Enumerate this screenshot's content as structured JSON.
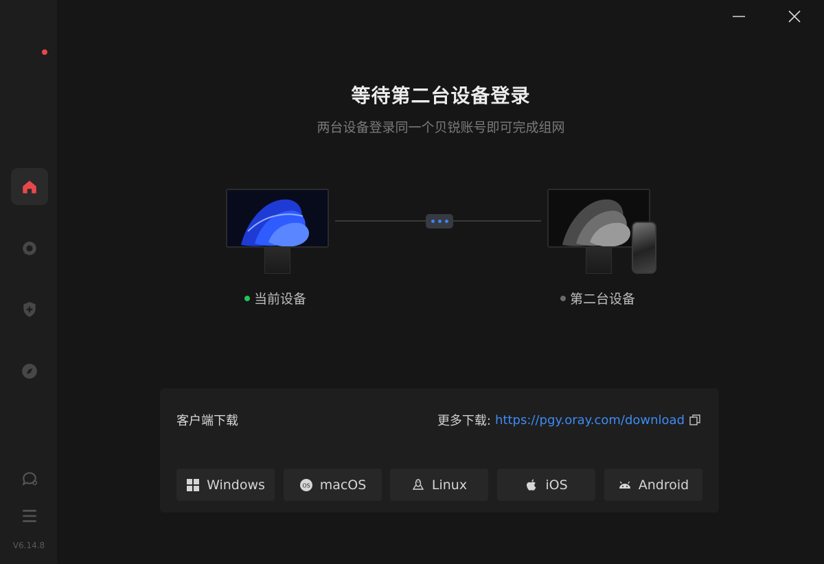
{
  "sidebar": {
    "version": "V6.14.8",
    "nav": [
      {
        "icon": "home-icon",
        "active": true
      },
      {
        "icon": "chat-bubble-icon"
      },
      {
        "icon": "shield-plus-icon"
      },
      {
        "icon": "compass-icon"
      }
    ],
    "bottom": [
      {
        "icon": "feedback-icon"
      },
      {
        "icon": "menu-icon"
      }
    ]
  },
  "window": {
    "minimize_icon": "minimize-icon",
    "close_icon": "close-icon"
  },
  "main": {
    "title": "等待第二台设备登录",
    "subtitle": "两台设备登录同一个贝锐账号即可完成组网",
    "current_device": {
      "label": "当前设备",
      "status_color": "#22c55e"
    },
    "second_device": {
      "label": "第二台设备",
      "status_color": "#6b6b6b"
    }
  },
  "download": {
    "title": "客户端下载",
    "more_label": "更多下载:",
    "url": "https://pgy.oray.com/download",
    "copy_icon": "copy-icon",
    "buttons": [
      {
        "label": "Windows",
        "icon": "windows-icon"
      },
      {
        "label": "macOS",
        "icon": "macos-icon"
      },
      {
        "label": "Linux",
        "icon": "linux-icon"
      },
      {
        "label": "iOS",
        "icon": "apple-icon"
      },
      {
        "label": "Android",
        "icon": "android-icon"
      }
    ]
  },
  "colors": {
    "accent": "#e8484b",
    "link": "#3d8bf5",
    "online": "#22c55e"
  }
}
